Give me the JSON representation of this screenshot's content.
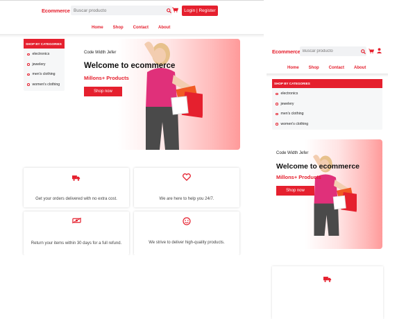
{
  "header": {
    "brand": "Ecommerce",
    "search_placeholder": "Buscar producto",
    "login_label": "Login | Register"
  },
  "nav": [
    {
      "label": "Home"
    },
    {
      "label": "Shop"
    },
    {
      "label": "Contact"
    },
    {
      "label": "About"
    }
  ],
  "categories": {
    "heading": "SHOP BY CATEGORIES",
    "items": [
      "electronics",
      "jewelery",
      "men's clothing",
      "women's clothing"
    ]
  },
  "hero": {
    "subtitle": "Code Width Jefer",
    "title": "Welcome to ecommerce",
    "tagline": "Millons+ Products",
    "cta": "Shop now"
  },
  "features": [
    {
      "icon": "truck-icon",
      "text": "Get your orders delivered with no extra cost."
    },
    {
      "icon": "heart-icon",
      "text": "We are here to help you 24/7."
    },
    {
      "icon": "money-icon",
      "text": "Return your items within 30 days for a full refund."
    },
    {
      "icon": "smile-icon",
      "text": "We strive to deliver high-quality products."
    }
  ],
  "colors": {
    "accent": "#e5202e",
    "panel": "#f6f7f8"
  }
}
